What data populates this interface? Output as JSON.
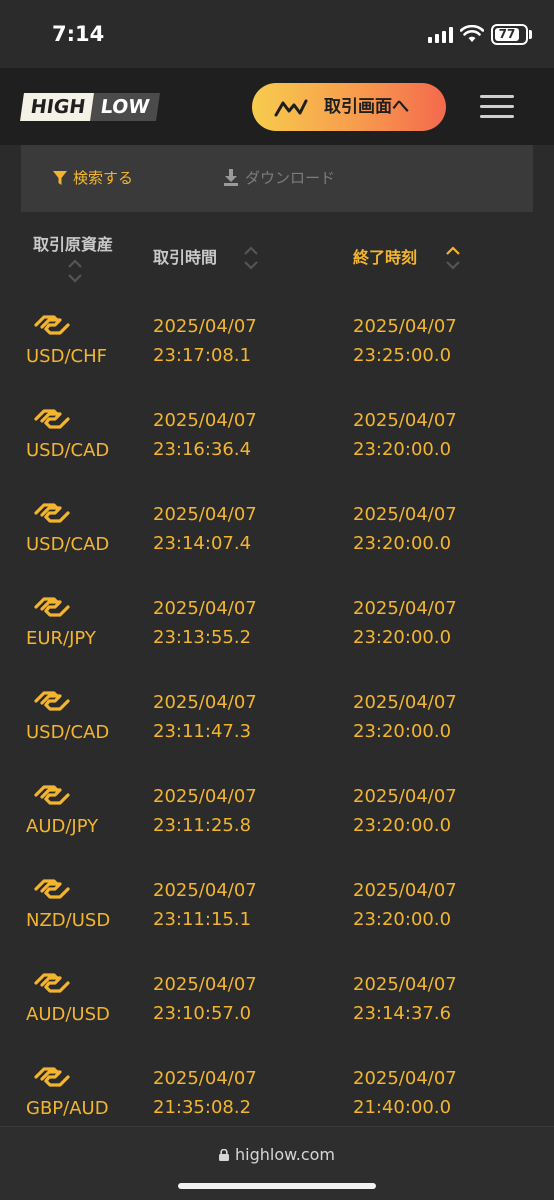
{
  "status_bar": {
    "time": "7:14",
    "battery": "77"
  },
  "header": {
    "logo_high": "HIGH",
    "logo_low": "LOW",
    "trade_button": "取引画面へ"
  },
  "toolbar": {
    "search_label": "検索する",
    "download_label": "ダウンロード"
  },
  "table": {
    "columns": {
      "asset": "取引原資産",
      "open_time": "取引時間",
      "end_time": "終了時刻"
    },
    "rows": [
      {
        "pair": "USD/CHF",
        "open_date": "2025/04/07",
        "open_time": "23:17:08.1",
        "end_date": "2025/04/07",
        "end_time": "23:25:00.0"
      },
      {
        "pair": "USD/CAD",
        "open_date": "2025/04/07",
        "open_time": "23:16:36.4",
        "end_date": "2025/04/07",
        "end_time": "23:20:00.0"
      },
      {
        "pair": "USD/CAD",
        "open_date": "2025/04/07",
        "open_time": "23:14:07.4",
        "end_date": "2025/04/07",
        "end_time": "23:20:00.0"
      },
      {
        "pair": "EUR/JPY",
        "open_date": "2025/04/07",
        "open_time": "23:13:55.2",
        "end_date": "2025/04/07",
        "end_time": "23:20:00.0"
      },
      {
        "pair": "USD/CAD",
        "open_date": "2025/04/07",
        "open_time": "23:11:47.3",
        "end_date": "2025/04/07",
        "end_time": "23:20:00.0"
      },
      {
        "pair": "AUD/JPY",
        "open_date": "2025/04/07",
        "open_time": "23:11:25.8",
        "end_date": "2025/04/07",
        "end_time": "23:20:00.0"
      },
      {
        "pair": "NZD/USD",
        "open_date": "2025/04/07",
        "open_time": "23:11:15.1",
        "end_date": "2025/04/07",
        "end_time": "23:20:00.0"
      },
      {
        "pair": "AUD/USD",
        "open_date": "2025/04/07",
        "open_time": "23:10:57.0",
        "end_date": "2025/04/07",
        "end_time": "23:14:37.6"
      },
      {
        "pair": "GBP/AUD",
        "open_date": "2025/04/07",
        "open_time": "21:35:08.2",
        "end_date": "2025/04/07",
        "end_time": "21:40:00.0"
      }
    ]
  },
  "browser": {
    "url": "highlow.com"
  },
  "icons": {
    "filter": "filter-icon",
    "download": "download-icon",
    "pair": "currency-pair-icon",
    "sort": "sort-icon",
    "menu": "hamburger-menu-icon",
    "lock": "lock-icon"
  },
  "colors": {
    "accent": "#f3b52f",
    "header_bg": "#1f1f1f",
    "page_bg": "#2b2b2b"
  }
}
